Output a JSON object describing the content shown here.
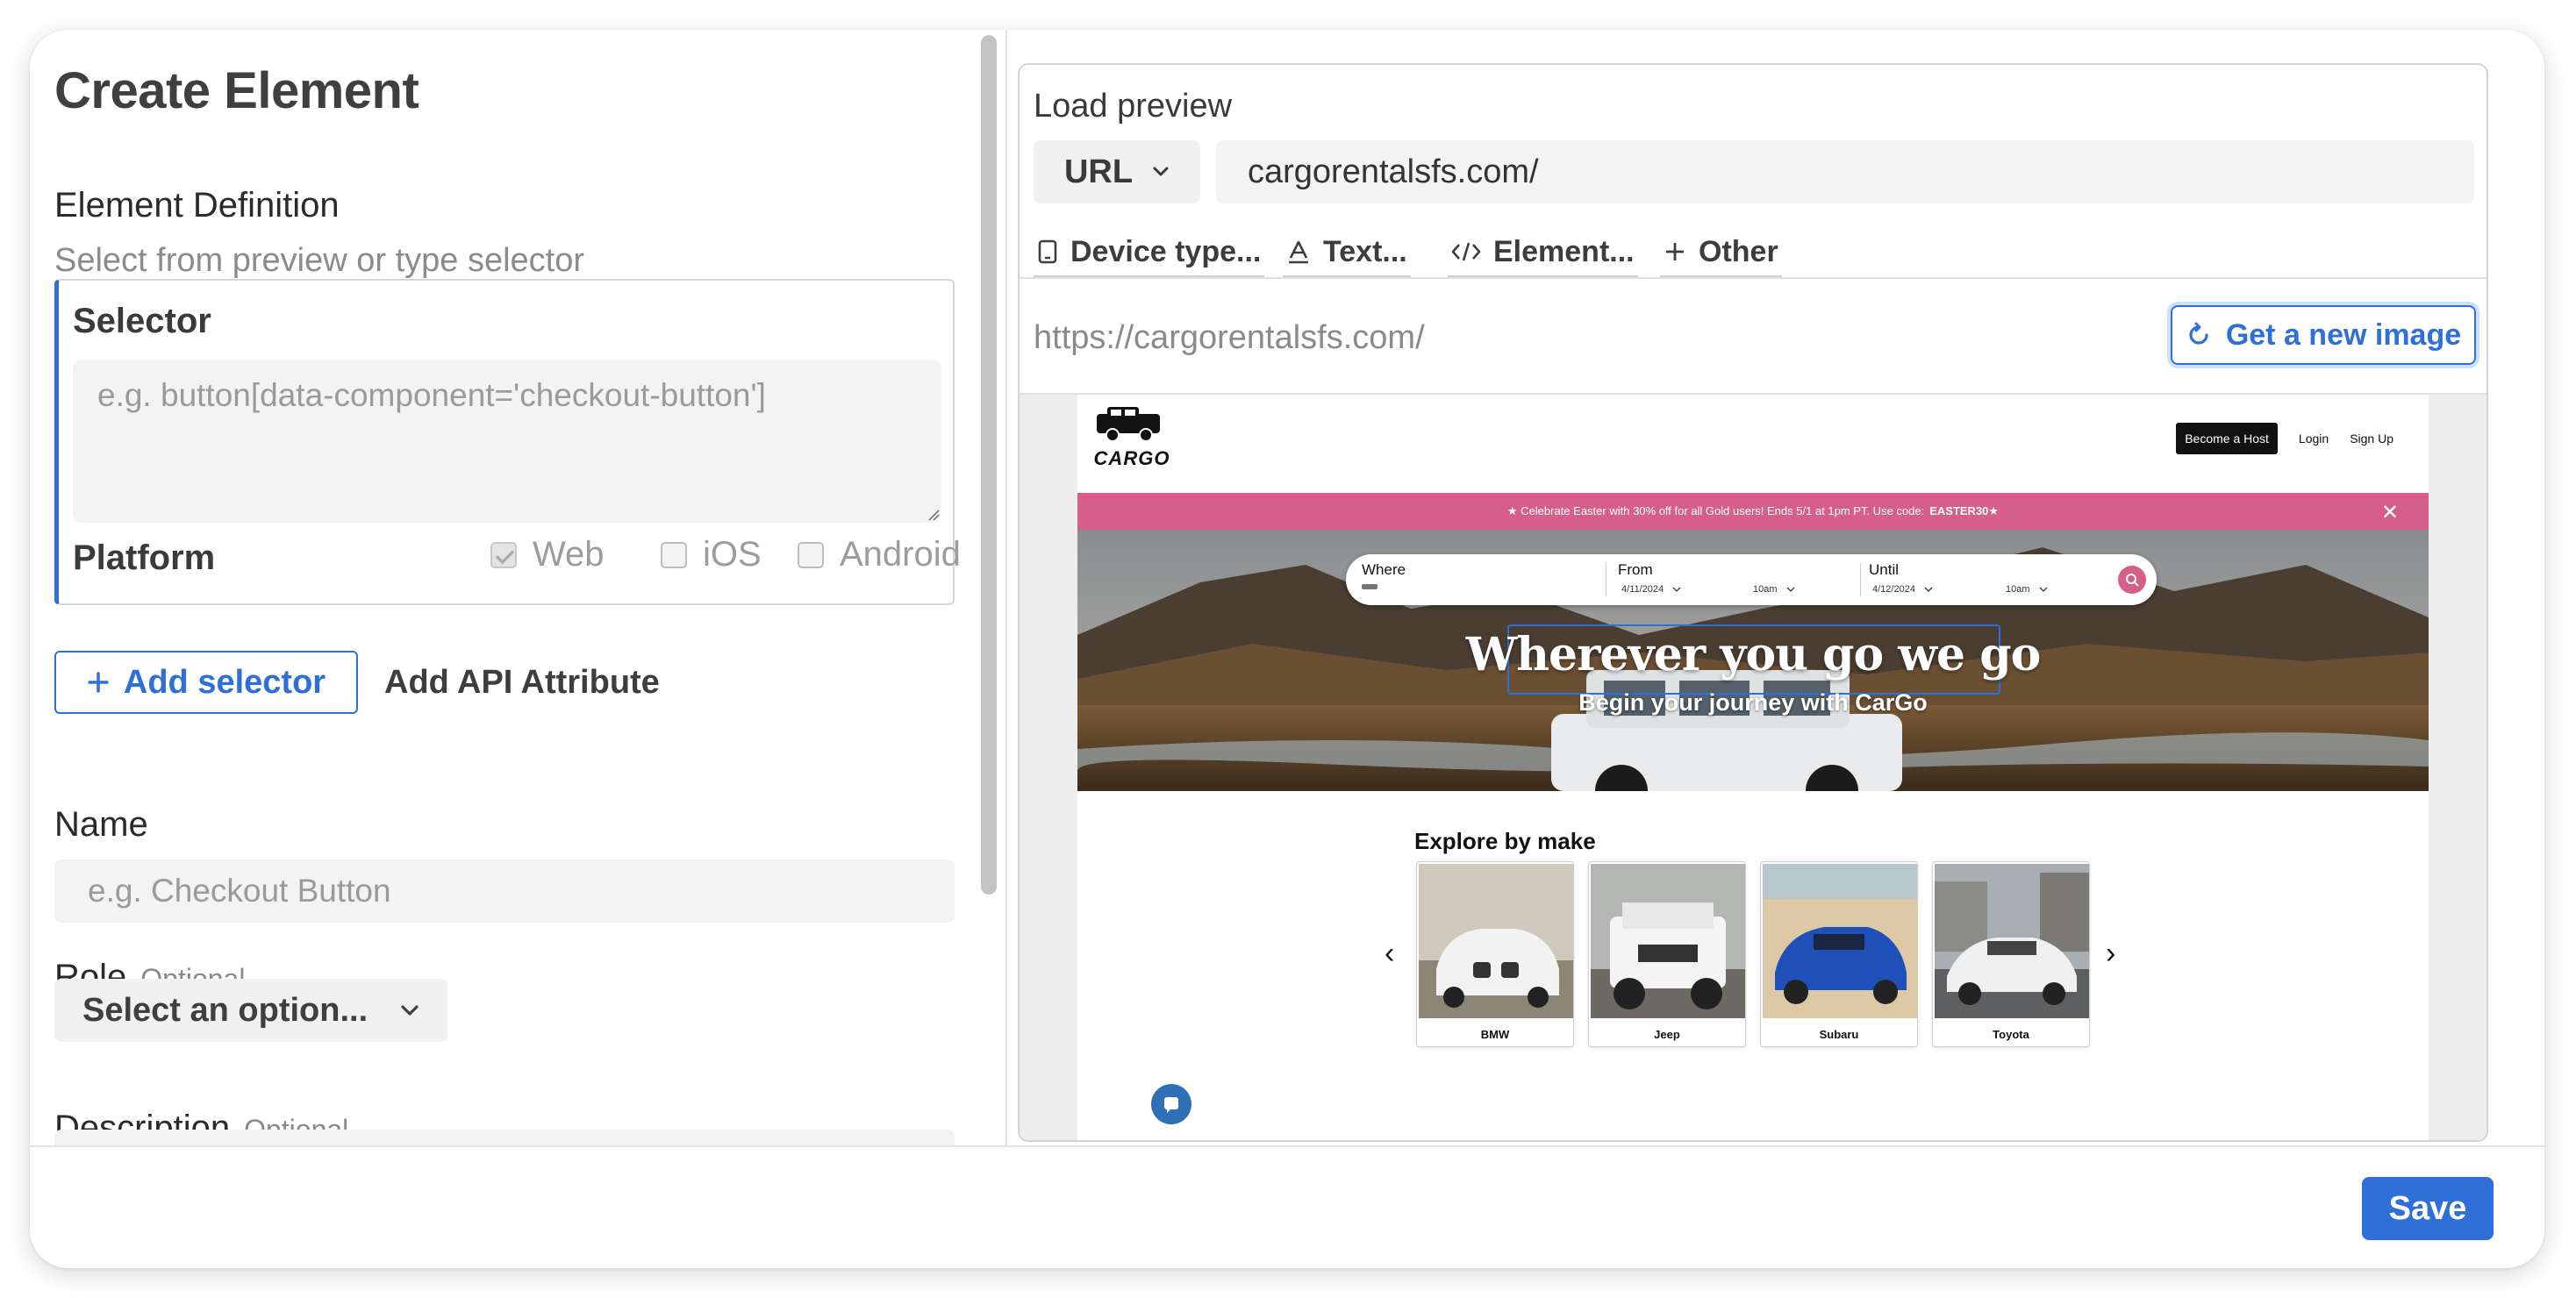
{
  "form": {
    "title": "Create Element",
    "element_definition_label": "Element Definition",
    "element_definition_helper": "Select from preview or type selector",
    "selector": {
      "title": "Selector",
      "placeholder": "e.g. button[data-component='checkout-button']",
      "platform_label": "Platform",
      "platforms": [
        {
          "label": "Web",
          "checked": true
        },
        {
          "label": "iOS",
          "checked": false
        },
        {
          "label": "Android",
          "checked": false
        }
      ]
    },
    "add_selector_label": "Add selector",
    "add_api_attribute_label": "Add API Attribute",
    "name_label": "Name",
    "name_placeholder": "e.g. Checkout Button",
    "role_label": "Role",
    "role_optional": "Optional",
    "role_select_value": "Select an option...",
    "description_label": "Description",
    "description_optional": "Optional"
  },
  "preview": {
    "title": "Load preview",
    "source_type": "URL",
    "url_value": "cargorentalsfs.com/",
    "options": [
      {
        "label": "Device type...",
        "icon": "device-icon"
      },
      {
        "label": "Text...",
        "icon": "text-icon"
      },
      {
        "label": "Element...",
        "icon": "code-icon"
      },
      {
        "label": "Other",
        "icon": "plus-icon"
      }
    ],
    "loaded_url": "https://cargorentalsfs.com/",
    "new_image_label": "Get a new image"
  },
  "site": {
    "logo_text": "CARGO",
    "nav": {
      "host_button": "Become a Host",
      "login": "Login",
      "signup": "Sign Up"
    },
    "promo_text": "★ Celebrate Easter with 30% off for all Gold users! Ends 5/1 at 1pm PT. Use code:",
    "promo_code": "EASTER30★",
    "promo_close": "✕",
    "search": {
      "where_label": "Where",
      "from_label": "From",
      "from_date": "4/11/2024",
      "from_time": "10am",
      "until_label": "Until",
      "until_date": "4/12/2024",
      "until_time": "10am"
    },
    "hero_title": "Wherever you go we go",
    "hero_subtitle": "Begin your journey with CarGo",
    "explore_title": "Explore by make",
    "makes": [
      "BMW",
      "Jeep",
      "Subaru",
      "Toyota"
    ],
    "prev_arrow": "‹",
    "next_arrow": "›",
    "colors": {
      "promo": "#d65f8a",
      "bmw": "#f2f2f2",
      "jeep": "#f4f4f4",
      "subaru": "#1f4fb8",
      "toyota": "#f0f0f0"
    }
  },
  "footer": {
    "save_label": "Save"
  },
  "colors": {
    "accent": "#2f6fd8",
    "title": "#3f3f3f"
  }
}
